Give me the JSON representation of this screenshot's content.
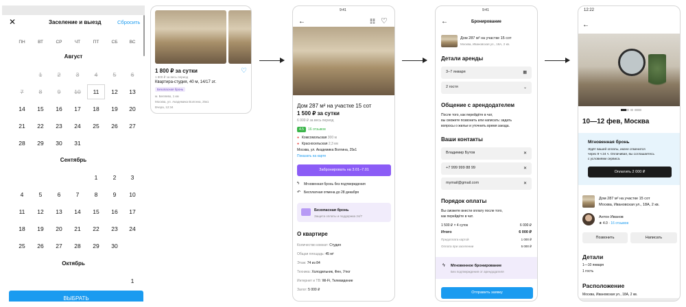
{
  "screen1": {
    "title": "Заселение и выезд",
    "reset": "Сбросить",
    "weekdays": [
      "ПН",
      "ВТ",
      "СР",
      "ЧТ",
      "ПТ",
      "СБ",
      "ВС"
    ],
    "month1": "Август",
    "month2": "Сентябрь",
    "month3": "Октябрь",
    "aug_rows": [
      [
        "",
        "1",
        "2",
        "3",
        "4",
        "5",
        "6"
      ],
      [
        "7",
        "8",
        "9",
        "10",
        "11",
        "12",
        "13"
      ],
      [
        "14",
        "15",
        "16",
        "17",
        "18",
        "19",
        "20"
      ],
      [
        "21",
        "22",
        "23",
        "24",
        "25",
        "26",
        "27"
      ],
      [
        "28",
        "29",
        "30",
        "31",
        "",
        "",
        ""
      ]
    ],
    "sep_rows": [
      [
        "",
        "",
        "",
        "",
        "1",
        "2",
        "3"
      ],
      [
        "4",
        "5",
        "6",
        "7",
        "8",
        "9",
        "10"
      ],
      [
        "11",
        "12",
        "13",
        "14",
        "15",
        "16",
        "17"
      ],
      [
        "18",
        "19",
        "20",
        "21",
        "22",
        "23",
        "24"
      ],
      [
        "25",
        "26",
        "27",
        "28",
        "29",
        "30",
        ""
      ]
    ],
    "oct_first": "1",
    "select_button": "ВЫБРАТЬ"
  },
  "screen2": {
    "price": "1 800 ₽ за сутки",
    "price_sub": "1 800 ₽ за весь период",
    "title": "Квартира-студия, 40 м, 14/17 эт.",
    "badge": "Безопасная бронь",
    "metro": "м. Беляево, 1 км",
    "address": "Москва, ул. Академика Волгина, 25к1",
    "date": "Вчера, 12:34"
  },
  "screen3": {
    "time": "9:41",
    "title": "Дом 287 м² на участке 15 сот",
    "price": "1 500 ₽ за сутки",
    "price_sub": "6 000 ₽ за весь период",
    "rating": "4.5",
    "reviews": "16 отзывов",
    "metro1": "Комсомольская",
    "metro1_dist": "300 м",
    "metro2": "Красносельская",
    "metro2_dist": "2,3 км",
    "address": "Москва, ул. Академика Волгина, 25к1",
    "map_link": "Показать на карте",
    "book_button": "Забронировать на 3.01–7.01",
    "feature1": "Мгновенная бронь без подтверждения",
    "feature2": "Бесплатная отмена до 28 декабря",
    "safe_title": "Безопасная бронь",
    "safe_sub": "Защита оплаты и поддержка 24/7",
    "about_title": "О квартире",
    "rooms_label": "Количество комнат:",
    "rooms_value": "Студия",
    "area_label": "Общая площадь:",
    "area_value": "45 м²",
    "floor_label": "Этаж:",
    "floor_value": "74 из 84",
    "tech_label": "Техника:",
    "tech_value": "Холодильник, Фен, Утюг",
    "net_label": "Интернет и ТВ:",
    "net_value": "Wi-Fi, Телевидение",
    "deposit_label": "Залог:",
    "deposit_value": "5 000 ₽"
  },
  "screen4": {
    "time": "9:41",
    "header": "Бронирование",
    "obj_title": "Дом 287 м² на участке 15 сот",
    "obj_addr": "Москва, Ивановская ул., 18А, 2 кв.",
    "rent_title": "Детали аренды",
    "dates": "3–7 января",
    "guests": "2 гостя",
    "contact_title": "Общение с арендодателем",
    "contact_text1": "После того, как перейдёте в чат,",
    "contact_text2": "вы сможете позвонить или написать: задать",
    "contact_text3": "вопросы о жилье и уточнить время заезда.",
    "your_contacts": "Ваши контакты",
    "name": "Владимир Бутов",
    "phone": "+7 999 999 88 99",
    "email": "mymail@gmail.com",
    "pay_title": "Порядок оплаты",
    "pay_text1": "Вы сможете внести оплату после того,",
    "pay_text2": "как перейдёте в чат.",
    "calc_label": "1 500 ₽ × 4 суток",
    "calc_value": "6 000 ₽",
    "total_label": "Итого",
    "total_value": "6 000 ₽",
    "prepay_label": "Предоплата картой",
    "prepay_value": "1 000 ₽",
    "checkin_label": "Оплата при заселении",
    "checkin_value": "5 000 ₽",
    "instant_title": "Мгновенное бронирование",
    "instant_sub": "Без подтверждения от арендодателя",
    "send_button": "Отправить заявку"
  },
  "screen5": {
    "time": "12:22",
    "dates_city": "10—12 фев, Москва",
    "instant_title": "Мгновенная бронь",
    "instant_text1": "Ждёт вашей оплаты, иначе отменится",
    "instant_text2": "через 9 ч 24 ч. Оплачивая, вы соглашаетесь",
    "instant_text3": "с условиями сервиса.",
    "pay_button": "Оплатить 2 000 ₽",
    "obj_title": "Дом 287 м² на участке 15 сот",
    "obj_addr": "Москва, Ивановская ул., 18А, 2 кв.",
    "host_name": "Антон Иванов",
    "host_rating": "4.0",
    "host_reviews": "16 отзывов",
    "call_button": "Позвонить",
    "write_button": "Написать",
    "details_title": "Детали",
    "details_dates": "1—10 января",
    "details_guests": "1 гость",
    "location_title": "Расположение",
    "location_addr": "Москва, Ивановская ул., 18А, 2 кв."
  },
  "colors": {
    "accent_blue": "#1a9bf0",
    "purple": "#8b5cf6",
    "lilac_bg": "#f1ecfb",
    "green_badge": "#3bb54a",
    "dark_button": "#1b1b1b",
    "light_blue_bg": "#e7f4fc"
  }
}
